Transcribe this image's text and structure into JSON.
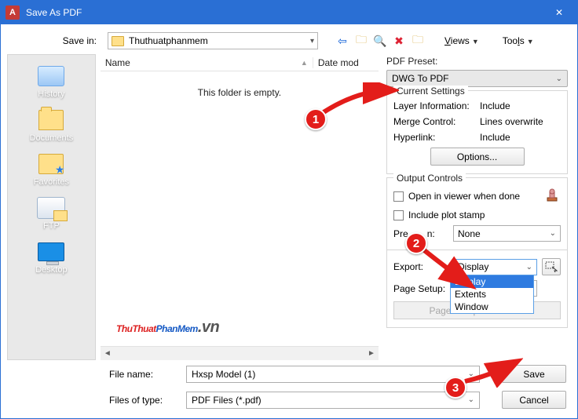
{
  "window": {
    "app_letter": "A",
    "title": "Save As PDF",
    "close_glyph": "✕"
  },
  "top": {
    "save_in_label": "Save in:",
    "save_in_value": "Thuthuatphanmem",
    "views_label": "Views",
    "tools_label": "Tools"
  },
  "sidebar": {
    "items": [
      {
        "label": "History"
      },
      {
        "label": "Documents"
      },
      {
        "label": "Favorites"
      },
      {
        "label": "FTP"
      },
      {
        "label": "Desktop"
      }
    ]
  },
  "filelist": {
    "col_name": "Name",
    "col_date": "Date mod",
    "empty_msg": "This folder is empty."
  },
  "right": {
    "preset_label": "PDF Preset:",
    "preset_value": "DWG To PDF",
    "current_settings_title": "Current Settings",
    "layer_info_k": "Layer Information:",
    "layer_info_v": "Include",
    "merge_k": "Merge Control:",
    "merge_v": "Lines overwrite",
    "hyperlink_k": "Hyperlink:",
    "hyperlink_v": "Include",
    "options_label": "Options...",
    "output_title": "Output Controls",
    "open_viewer_label": "Open in viewer when done",
    "include_stamp_label": "Include plot stamp",
    "precision_label_partial": "Pre",
    "precision_label_after": "n:",
    "precision_value": "None",
    "export_label": "Export:",
    "export_value": "Display",
    "export_options": [
      "Display",
      "Extents",
      "Window"
    ],
    "page_setup_label": "Page Setup:",
    "override_label": "Page Setup Override..."
  },
  "bottom": {
    "file_name_label": "File name:",
    "file_name_value": "Hxsp Model (1)",
    "files_type_label": "Files of type:",
    "files_type_value": "PDF Files (*.pdf)",
    "save_label": "Save",
    "cancel_label": "Cancel"
  },
  "watermark": {
    "part1": "ThuThuat",
    "part2": "PhanMem",
    "part3": ".vn"
  },
  "annot": {
    "b1": "1",
    "b2": "2",
    "b3": "3"
  }
}
